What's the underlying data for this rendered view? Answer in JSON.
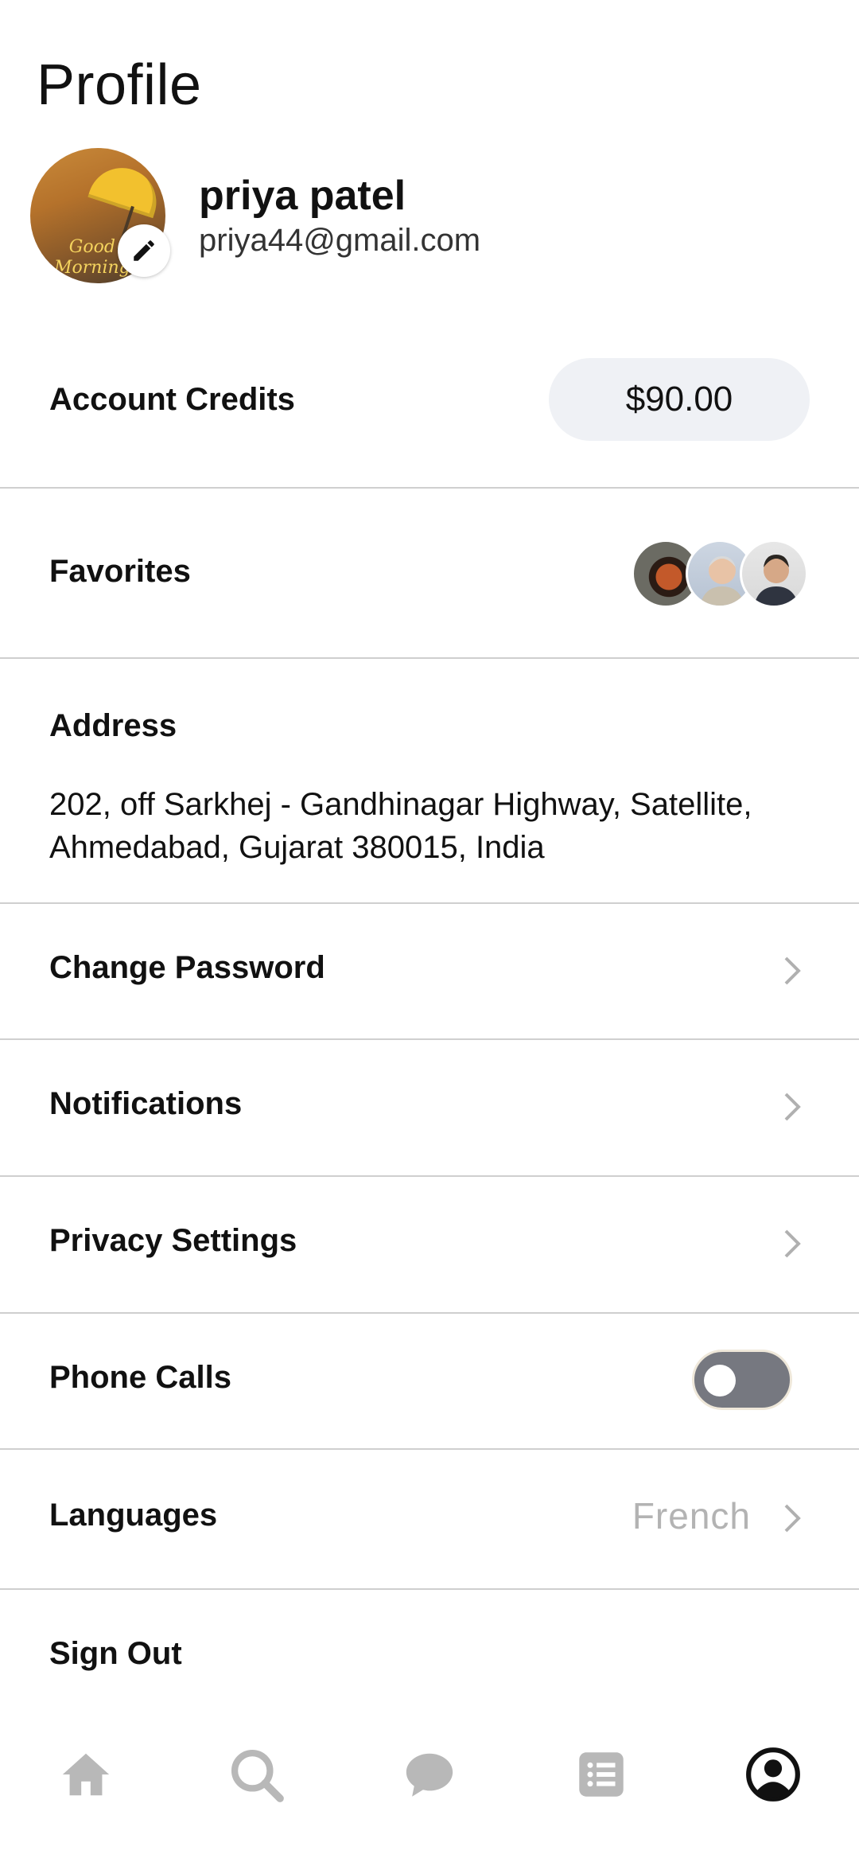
{
  "header": {
    "title": "Profile"
  },
  "user": {
    "name": "priya patel",
    "email": "priya44@gmail.com",
    "avatar_text_line1": "Good",
    "avatar_text_line2": "Morning"
  },
  "account_credits": {
    "label": "Account Credits",
    "value": "$90.00"
  },
  "favorites": {
    "label": "Favorites",
    "count_shown": 3
  },
  "address": {
    "label": "Address",
    "text": "202, off Sarkhej - Gandhinagar Highway, Satellite, Ahmedabad, Gujarat 380015, India"
  },
  "menu": {
    "change_password": "Change Password",
    "notifications": "Notifications",
    "privacy_settings": "Privacy Settings",
    "phone_calls": "Phone Calls",
    "phone_calls_enabled": false,
    "languages": "Languages",
    "language_value": "French",
    "sign_out": "Sign Out"
  },
  "tabbar": {
    "icons": [
      "home-icon",
      "search-icon",
      "chat-icon",
      "list-icon",
      "profile-icon"
    ],
    "active": "profile-icon"
  },
  "colors": {
    "text": "#111111",
    "muted": "#b3b3b3",
    "divider": "#cfcfcf",
    "pill": "#eff1f5",
    "toggle_off": "#767880",
    "tab_inactive": "#b8b8b8",
    "tab_active": "#111111"
  }
}
